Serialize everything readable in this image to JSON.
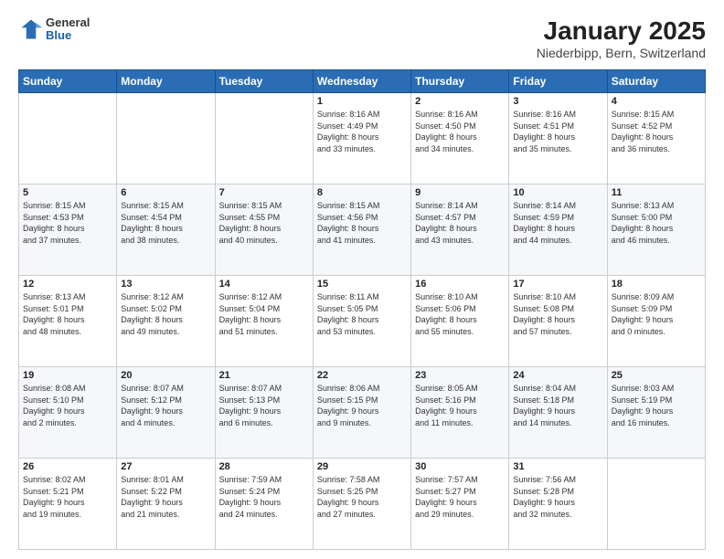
{
  "header": {
    "logo_general": "General",
    "logo_blue": "Blue",
    "title": "January 2025",
    "subtitle": "Niederbipp, Bern, Switzerland"
  },
  "weekdays": [
    "Sunday",
    "Monday",
    "Tuesday",
    "Wednesday",
    "Thursday",
    "Friday",
    "Saturday"
  ],
  "weeks": [
    [
      {
        "day": "",
        "info": ""
      },
      {
        "day": "",
        "info": ""
      },
      {
        "day": "",
        "info": ""
      },
      {
        "day": "1",
        "info": "Sunrise: 8:16 AM\nSunset: 4:49 PM\nDaylight: 8 hours\nand 33 minutes."
      },
      {
        "day": "2",
        "info": "Sunrise: 8:16 AM\nSunset: 4:50 PM\nDaylight: 8 hours\nand 34 minutes."
      },
      {
        "day": "3",
        "info": "Sunrise: 8:16 AM\nSunset: 4:51 PM\nDaylight: 8 hours\nand 35 minutes."
      },
      {
        "day": "4",
        "info": "Sunrise: 8:15 AM\nSunset: 4:52 PM\nDaylight: 8 hours\nand 36 minutes."
      }
    ],
    [
      {
        "day": "5",
        "info": "Sunrise: 8:15 AM\nSunset: 4:53 PM\nDaylight: 8 hours\nand 37 minutes."
      },
      {
        "day": "6",
        "info": "Sunrise: 8:15 AM\nSunset: 4:54 PM\nDaylight: 8 hours\nand 38 minutes."
      },
      {
        "day": "7",
        "info": "Sunrise: 8:15 AM\nSunset: 4:55 PM\nDaylight: 8 hours\nand 40 minutes."
      },
      {
        "day": "8",
        "info": "Sunrise: 8:15 AM\nSunset: 4:56 PM\nDaylight: 8 hours\nand 41 minutes."
      },
      {
        "day": "9",
        "info": "Sunrise: 8:14 AM\nSunset: 4:57 PM\nDaylight: 8 hours\nand 43 minutes."
      },
      {
        "day": "10",
        "info": "Sunrise: 8:14 AM\nSunset: 4:59 PM\nDaylight: 8 hours\nand 44 minutes."
      },
      {
        "day": "11",
        "info": "Sunrise: 8:13 AM\nSunset: 5:00 PM\nDaylight: 8 hours\nand 46 minutes."
      }
    ],
    [
      {
        "day": "12",
        "info": "Sunrise: 8:13 AM\nSunset: 5:01 PM\nDaylight: 8 hours\nand 48 minutes."
      },
      {
        "day": "13",
        "info": "Sunrise: 8:12 AM\nSunset: 5:02 PM\nDaylight: 8 hours\nand 49 minutes."
      },
      {
        "day": "14",
        "info": "Sunrise: 8:12 AM\nSunset: 5:04 PM\nDaylight: 8 hours\nand 51 minutes."
      },
      {
        "day": "15",
        "info": "Sunrise: 8:11 AM\nSunset: 5:05 PM\nDaylight: 8 hours\nand 53 minutes."
      },
      {
        "day": "16",
        "info": "Sunrise: 8:10 AM\nSunset: 5:06 PM\nDaylight: 8 hours\nand 55 minutes."
      },
      {
        "day": "17",
        "info": "Sunrise: 8:10 AM\nSunset: 5:08 PM\nDaylight: 8 hours\nand 57 minutes."
      },
      {
        "day": "18",
        "info": "Sunrise: 8:09 AM\nSunset: 5:09 PM\nDaylight: 9 hours\nand 0 minutes."
      }
    ],
    [
      {
        "day": "19",
        "info": "Sunrise: 8:08 AM\nSunset: 5:10 PM\nDaylight: 9 hours\nand 2 minutes."
      },
      {
        "day": "20",
        "info": "Sunrise: 8:07 AM\nSunset: 5:12 PM\nDaylight: 9 hours\nand 4 minutes."
      },
      {
        "day": "21",
        "info": "Sunrise: 8:07 AM\nSunset: 5:13 PM\nDaylight: 9 hours\nand 6 minutes."
      },
      {
        "day": "22",
        "info": "Sunrise: 8:06 AM\nSunset: 5:15 PM\nDaylight: 9 hours\nand 9 minutes."
      },
      {
        "day": "23",
        "info": "Sunrise: 8:05 AM\nSunset: 5:16 PM\nDaylight: 9 hours\nand 11 minutes."
      },
      {
        "day": "24",
        "info": "Sunrise: 8:04 AM\nSunset: 5:18 PM\nDaylight: 9 hours\nand 14 minutes."
      },
      {
        "day": "25",
        "info": "Sunrise: 8:03 AM\nSunset: 5:19 PM\nDaylight: 9 hours\nand 16 minutes."
      }
    ],
    [
      {
        "day": "26",
        "info": "Sunrise: 8:02 AM\nSunset: 5:21 PM\nDaylight: 9 hours\nand 19 minutes."
      },
      {
        "day": "27",
        "info": "Sunrise: 8:01 AM\nSunset: 5:22 PM\nDaylight: 9 hours\nand 21 minutes."
      },
      {
        "day": "28",
        "info": "Sunrise: 7:59 AM\nSunset: 5:24 PM\nDaylight: 9 hours\nand 24 minutes."
      },
      {
        "day": "29",
        "info": "Sunrise: 7:58 AM\nSunset: 5:25 PM\nDaylight: 9 hours\nand 27 minutes."
      },
      {
        "day": "30",
        "info": "Sunrise: 7:57 AM\nSunset: 5:27 PM\nDaylight: 9 hours\nand 29 minutes."
      },
      {
        "day": "31",
        "info": "Sunrise: 7:56 AM\nSunset: 5:28 PM\nDaylight: 9 hours\nand 32 minutes."
      },
      {
        "day": "",
        "info": ""
      }
    ]
  ]
}
